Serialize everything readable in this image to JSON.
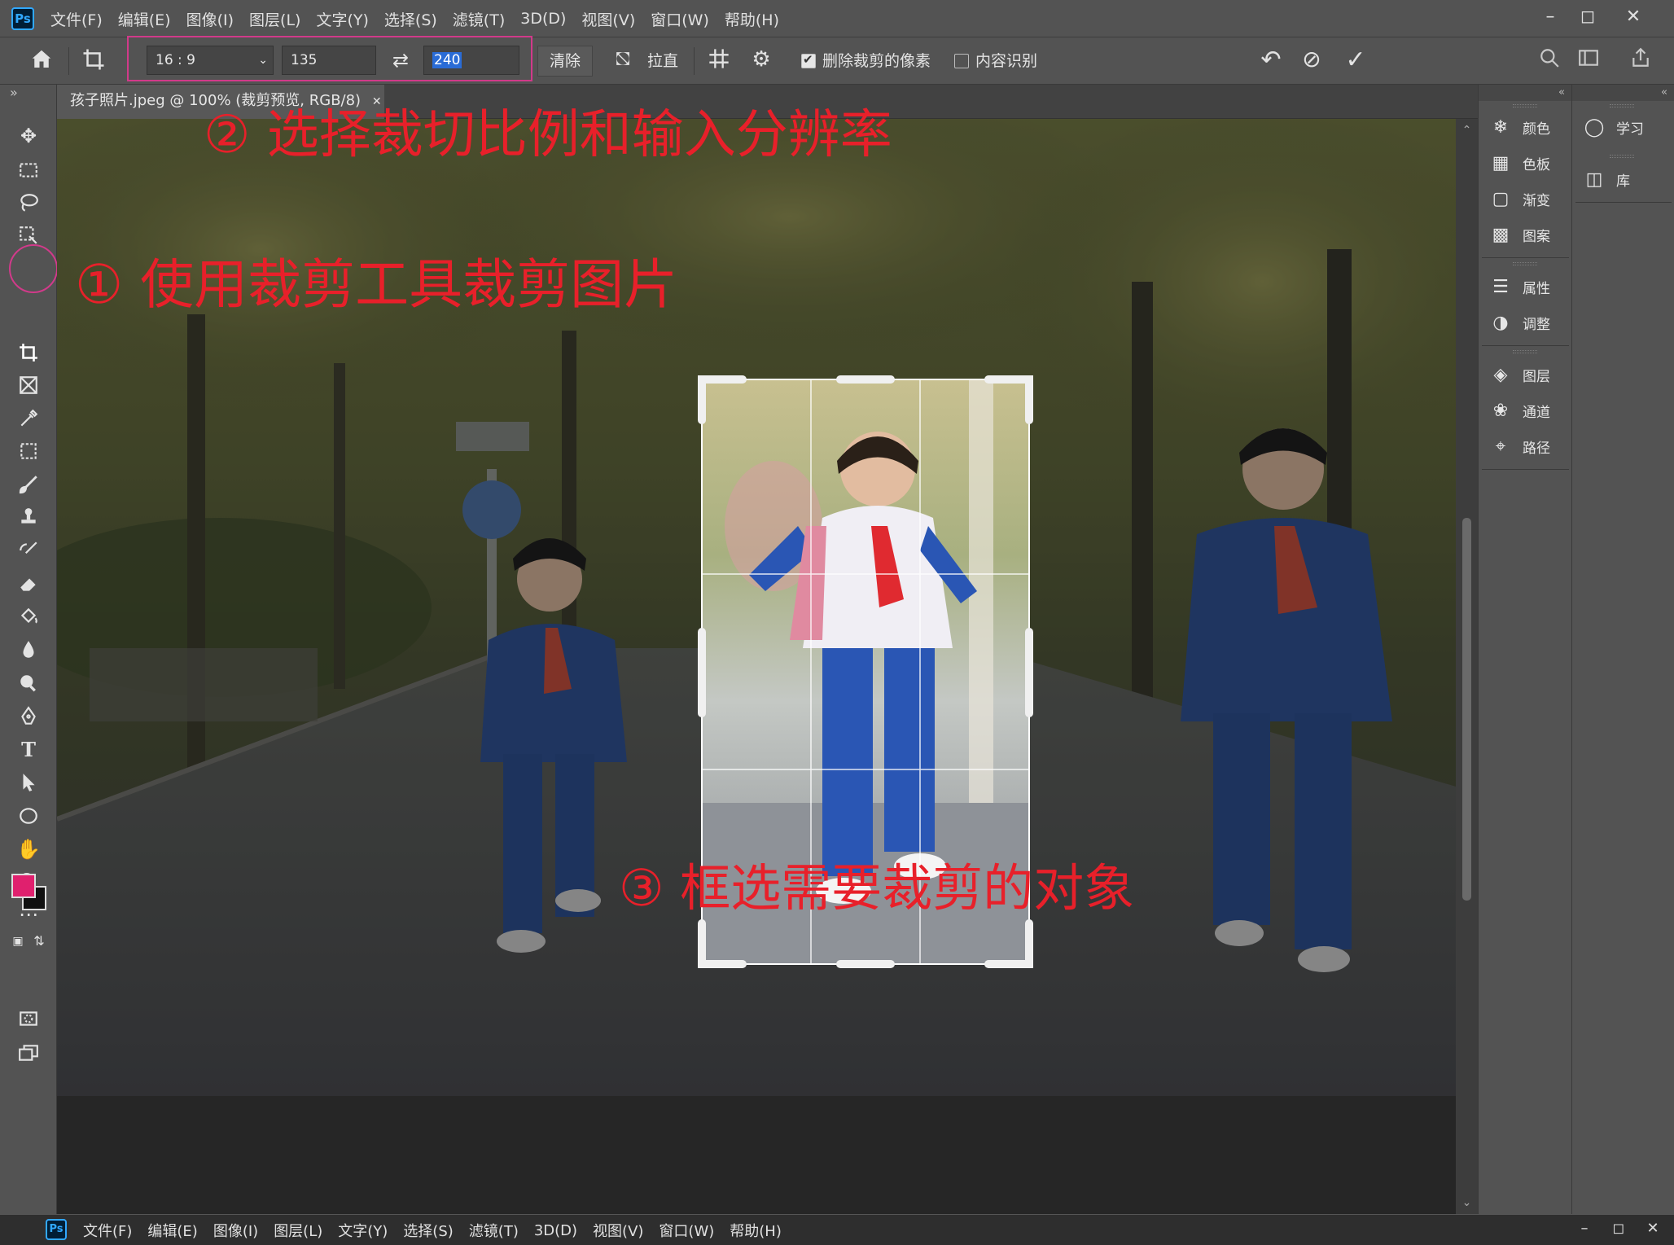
{
  "app": {
    "logo": "Ps",
    "menu": [
      "文件(F)",
      "编辑(E)",
      "图像(I)",
      "图层(L)",
      "文字(Y)",
      "选择(S)",
      "滤镜(T)",
      "3D(D)",
      "视图(V)",
      "窗口(W)",
      "帮助(H)"
    ],
    "window_controls": [
      "minimize-icon",
      "maximize-icon",
      "close-icon"
    ]
  },
  "options_bar": {
    "ratio": "16 : 9",
    "width_value": "135",
    "height_value": "240",
    "clear_label": "清除",
    "straighten_label": "拉直",
    "delete_cropped_label": "删除裁剪的像素",
    "delete_cropped_checked": true,
    "content_aware_label": "内容识别",
    "content_aware_checked": false,
    "icons": [
      "home-icon",
      "crop-tool-icon",
      "swap-icon",
      "straighten-icon",
      "overlay-grid-icon",
      "settings-gear-icon",
      "reset-icon",
      "cancel-icon",
      "commit-check-icon",
      "search-icon",
      "workspace-icon",
      "share-icon"
    ]
  },
  "document": {
    "tab_title": "孩子照片.jpeg @ 100% (裁剪预览, RGB/8)"
  },
  "toolbar": {
    "tools": [
      "move-icon",
      "marquee-icon",
      "lasso-icon",
      "object-select-icon",
      "crop-icon",
      "frame-icon",
      "eyedropper-icon",
      "healing-icon",
      "brush-icon",
      "stamp-icon",
      "history-brush-icon",
      "eraser-icon",
      "paint-bucket-icon",
      "blur-icon",
      "dodge-icon",
      "pen-icon",
      "type-icon",
      "path-select-icon",
      "ellipse-icon",
      "hand-icon",
      "zoom-icon",
      "more-tools-icon"
    ],
    "type_glyph": "T",
    "foreground_color": "#e0206e",
    "background_color": "#111111"
  },
  "panels": {
    "group1": [
      "颜色",
      "色板",
      "渐变",
      "图案"
    ],
    "group2": [
      "属性",
      "调整"
    ],
    "group3": [
      "图层",
      "通道",
      "路径"
    ],
    "column2": [
      "学习",
      "库"
    ]
  },
  "taskbar": {
    "logo": "Ps",
    "menu": [
      "文件(F)",
      "编辑(E)",
      "图像(I)",
      "图层(L)",
      "文字(Y)",
      "选择(S)",
      "滤镜(T)",
      "3D(D)",
      "视图(V)",
      "窗口(W)",
      "帮助(H)"
    ]
  },
  "annotations": {
    "step1": "① 使用裁剪工具裁剪图片",
    "step2": "② 选择裁切比例和输入分辨率",
    "step3": "③ 框选需要裁剪的对象"
  },
  "colors": {
    "annotation": "#e8202a",
    "highlight": "#d13a8a",
    "accent_blue": "#31a8ff"
  }
}
